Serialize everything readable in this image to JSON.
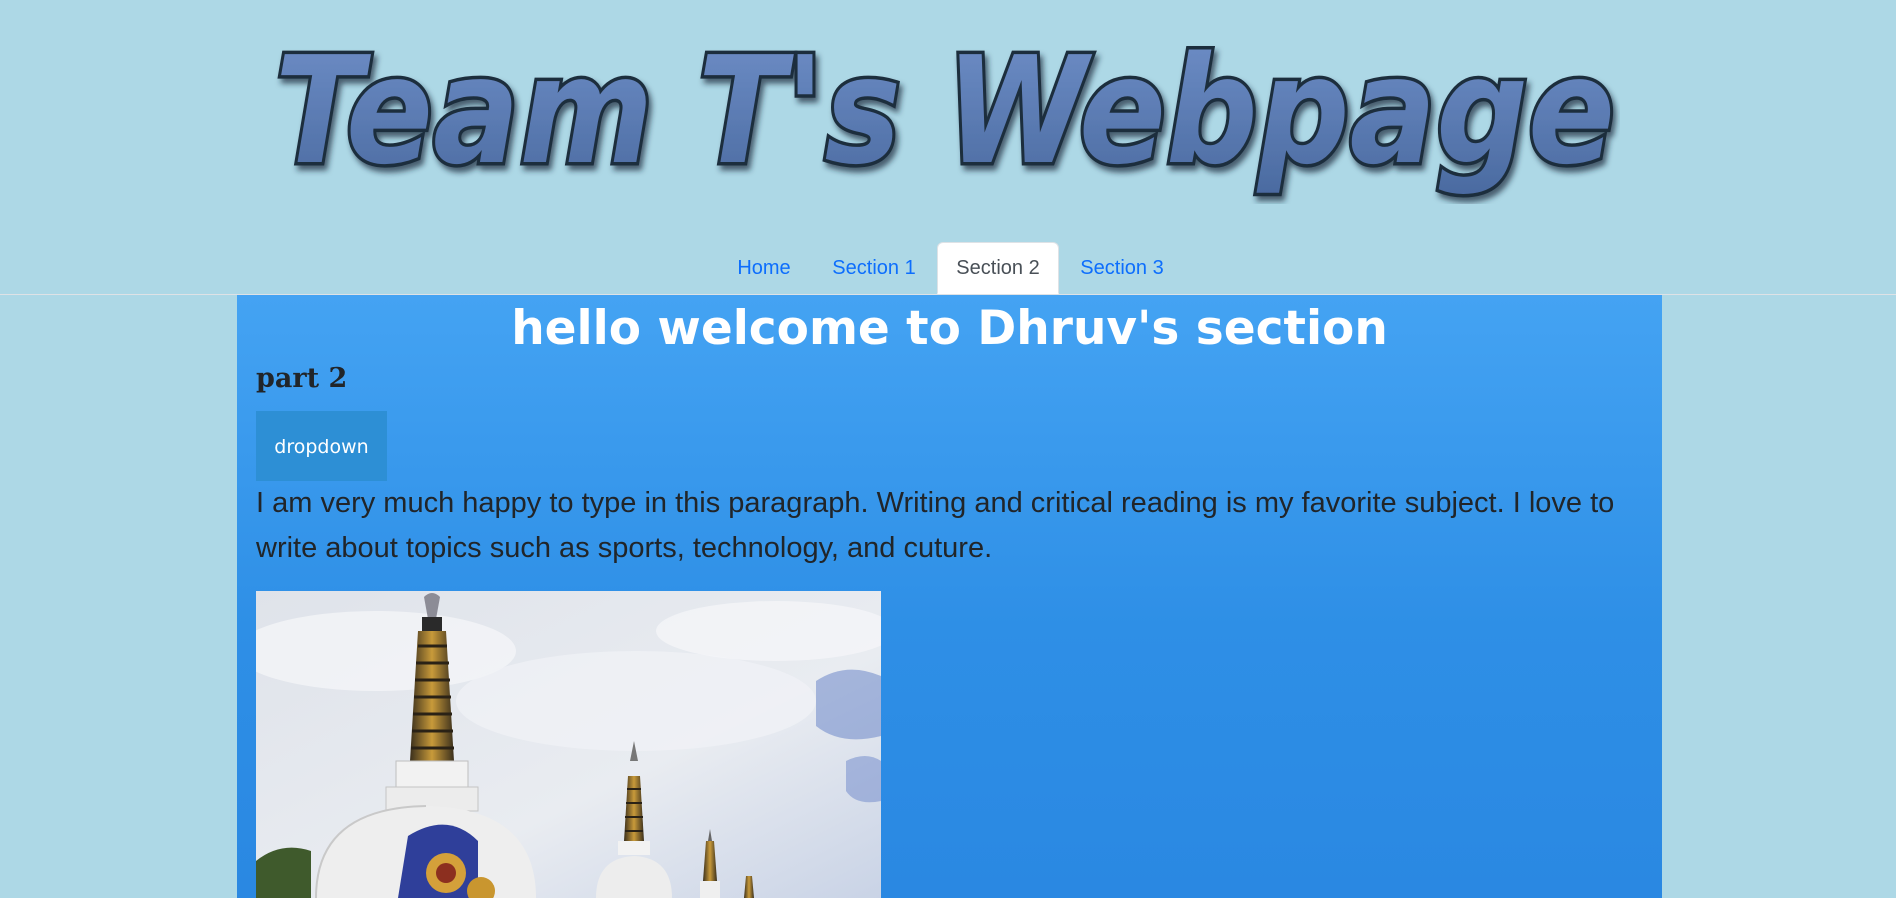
{
  "header": {
    "banner_text": "Team T's Webpage"
  },
  "nav": {
    "tabs": [
      {
        "label": "Home"
      },
      {
        "label": "Section 1"
      },
      {
        "label": "Section 2",
        "active": true
      },
      {
        "label": "Section 3"
      }
    ]
  },
  "main": {
    "title": "hello welcome to Dhruv's section",
    "subtitle": "part 2",
    "dropdown_label": "dropdown",
    "paragraph": "I am very much happy to type in this paragraph. Writing and critical reading is my favorite subject. I love to write about topics such as sports, technology, and cuture."
  },
  "colors": {
    "page_bg": "#add8e6",
    "link": "#0d6efd",
    "panel_top": "#44a3f3",
    "panel_bottom": "#2a88e2",
    "banner_fill": "#5b7fb8"
  }
}
